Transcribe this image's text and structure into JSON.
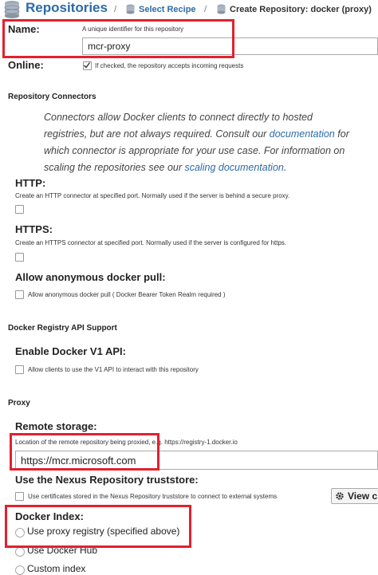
{
  "breadcrumb": {
    "root": "Repositories",
    "sep1": "/",
    "recipe": "Select Recipe",
    "sep2": "/",
    "current": "Create Repository: docker (proxy)"
  },
  "name": {
    "label": "Name:",
    "help": "A unique identifier for this repository",
    "value": "mcr-proxy"
  },
  "online": {
    "label": "Online:",
    "help": "If checked, the repository accepts incoming requests",
    "checked": true
  },
  "connectors": {
    "section": "Repository Connectors",
    "desc_1": "Connectors allow Docker clients to connect directly to hosted",
    "desc_2_pre": "registries, but are not always required. Consult our ",
    "desc_2_link": "documentation",
    "desc_2_post": " for",
    "desc_3": "which connector is appropriate for your use case. For information on",
    "desc_4_pre": "scaling the repositories see our ",
    "desc_4_link": "scaling documentation",
    "desc_4_post": ".",
    "http_label": "HTTP:",
    "http_help": "Create an HTTP connector at specified port. Normally used if the server is behind a secure proxy.",
    "https_label": "HTTPS:",
    "https_help": "Create an HTTPS connector at specified port. Normally used if the server is configured for https.",
    "anon_label": "Allow anonymous docker pull:",
    "anon_help": "Allow anonymous docker pull ( Docker Bearer Token Realm required )"
  },
  "api": {
    "section": "Docker Registry API Support",
    "v1_label": "Enable Docker V1 API:",
    "v1_help": "Allow clients to use the V1 API to interact with this repository"
  },
  "proxy": {
    "section": "Proxy",
    "remote_label": "Remote storage:",
    "remote_help": "Location of the remote repository being proxied, e.g. https://registry-1.docker.io",
    "remote_value": "https://mcr.microsoft.com",
    "truststore_label": "Use the Nexus Repository truststore:",
    "truststore_help": "Use certificates stored in the Nexus Repository truststore to connect to external systems",
    "view_button": "View c",
    "index_label": "Docker Index:",
    "index_options": [
      "Use proxy registry (specified above)",
      "Use Docker Hub",
      "Custom index"
    ]
  },
  "colors": {
    "accent": "#2c6aa8",
    "highlight": "#e3202f"
  }
}
